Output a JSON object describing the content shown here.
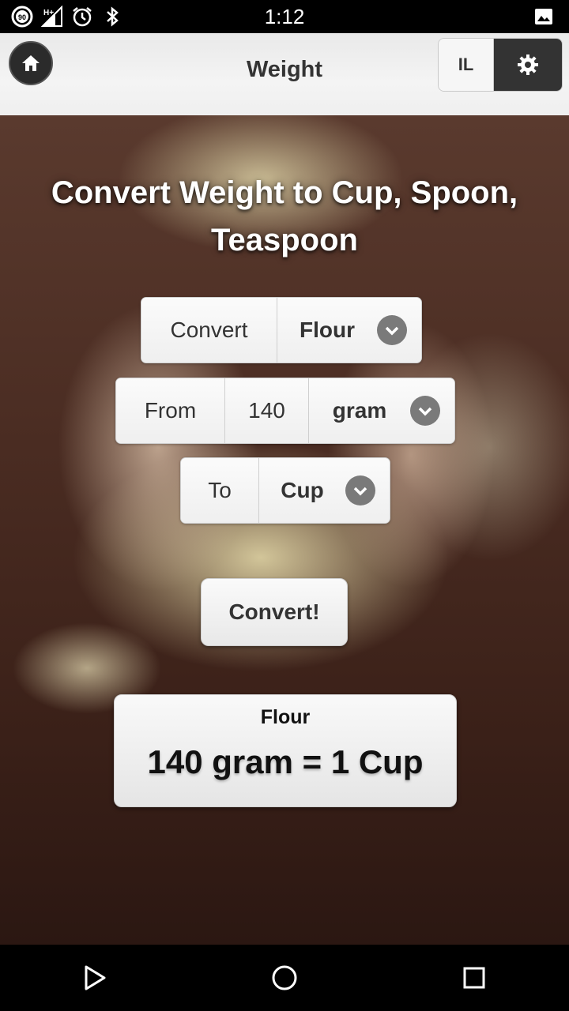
{
  "status_bar": {
    "time": "1:12",
    "icons": [
      "battery-90-icon",
      "signal-hplus-icon",
      "alarm-icon",
      "bluetooth-icon",
      "image-notification-icon"
    ],
    "battery_label": "90",
    "network_label": "H+"
  },
  "header": {
    "title": "Weight",
    "language_label": "IL",
    "home_icon": "home-icon",
    "settings_icon": "gear-icon"
  },
  "hero": {
    "heading": "Convert Weight to Cup, Spoon, Teaspoon"
  },
  "convert_row": {
    "label": "Convert",
    "ingredient": "Flour"
  },
  "from_row": {
    "label": "From",
    "amount": "140",
    "unit": "gram"
  },
  "to_row": {
    "label": "To",
    "unit": "Cup"
  },
  "convert_button": {
    "label": "Convert!"
  },
  "result": {
    "title": "Flour",
    "value": "140 gram = 1 Cup"
  },
  "nav": {
    "icons": [
      "back-icon",
      "home-circle-icon",
      "recents-icon"
    ]
  },
  "colors": {
    "header_bg": "#efefef",
    "dark_button": "#333333",
    "chevron": "#7a7a7a",
    "text": "#333333"
  }
}
